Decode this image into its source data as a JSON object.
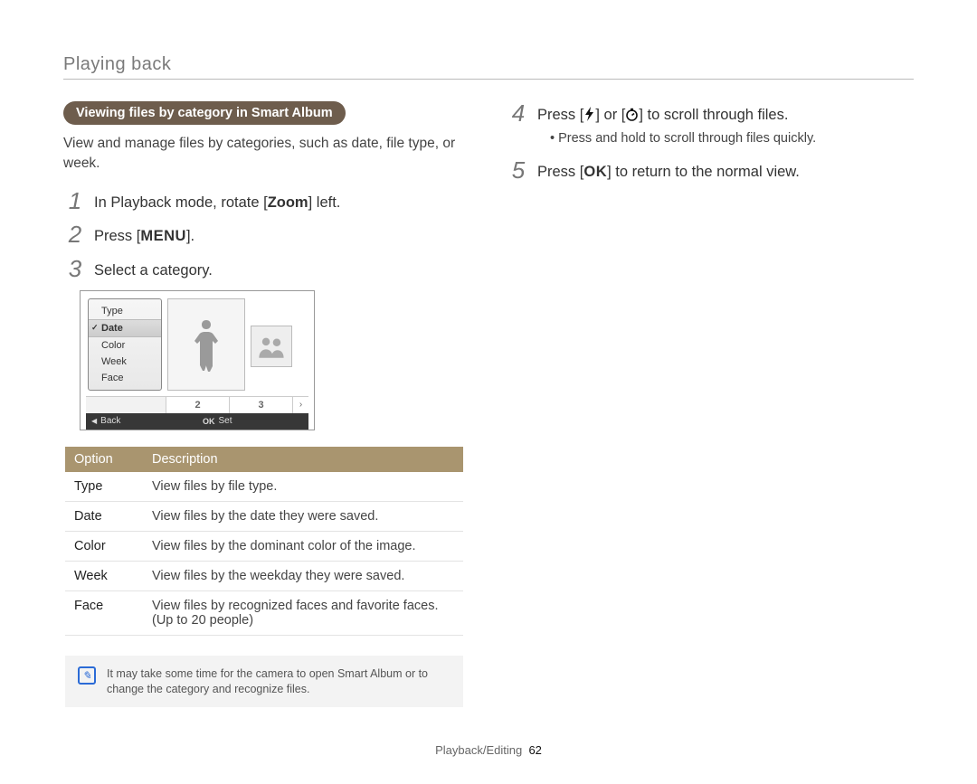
{
  "header": {
    "section": "Playing back"
  },
  "pill": "Viewing files by category in Smart Album",
  "lead": "View and manage files by categories, such as date, file type, or week.",
  "steps_left": [
    {
      "n": "1",
      "pre": "In Playback mode, rotate [",
      "mid": "Zoom",
      "post": "] left."
    },
    {
      "n": "2",
      "pre": "Press [",
      "mid": "MENU",
      "post": "]."
    },
    {
      "n": "3",
      "pre": "Select a category.",
      "mid": "",
      "post": ""
    }
  ],
  "screen": {
    "menu": [
      "Type",
      "Date",
      "Color",
      "Week",
      "Face"
    ],
    "selected": "Date",
    "paging": [
      "2",
      "3"
    ],
    "back": "Back",
    "set": "Set"
  },
  "table": {
    "head": {
      "option": "Option",
      "desc": "Description"
    },
    "rows": [
      {
        "k": "Type",
        "v": "View files by file type."
      },
      {
        "k": "Date",
        "v": "View files by the date they were saved."
      },
      {
        "k": "Color",
        "v": "View files by the dominant color of the image."
      },
      {
        "k": "Week",
        "v": "View files by the weekday they were saved."
      },
      {
        "k": "Face",
        "v": "View files by recognized faces and favorite faces. (Up to 20 people)"
      }
    ]
  },
  "note": "It may take some time for the camera to open Smart Album or to change the category and recognize files.",
  "steps_right": {
    "s4": {
      "n": "4",
      "pre": "Press [",
      "post1": "] or [",
      "post2": "] to scroll through files."
    },
    "s4_bullet": "Press and hold to scroll through files quickly.",
    "s5": {
      "n": "5",
      "pre": "Press [",
      "mid": "OK",
      "post": "] to return to the normal view."
    }
  },
  "footer": {
    "section": "Playback/Editing",
    "page": "62"
  },
  "icons": {
    "flash": "flash-icon",
    "timer": "timer-icon",
    "ok": "OK"
  }
}
